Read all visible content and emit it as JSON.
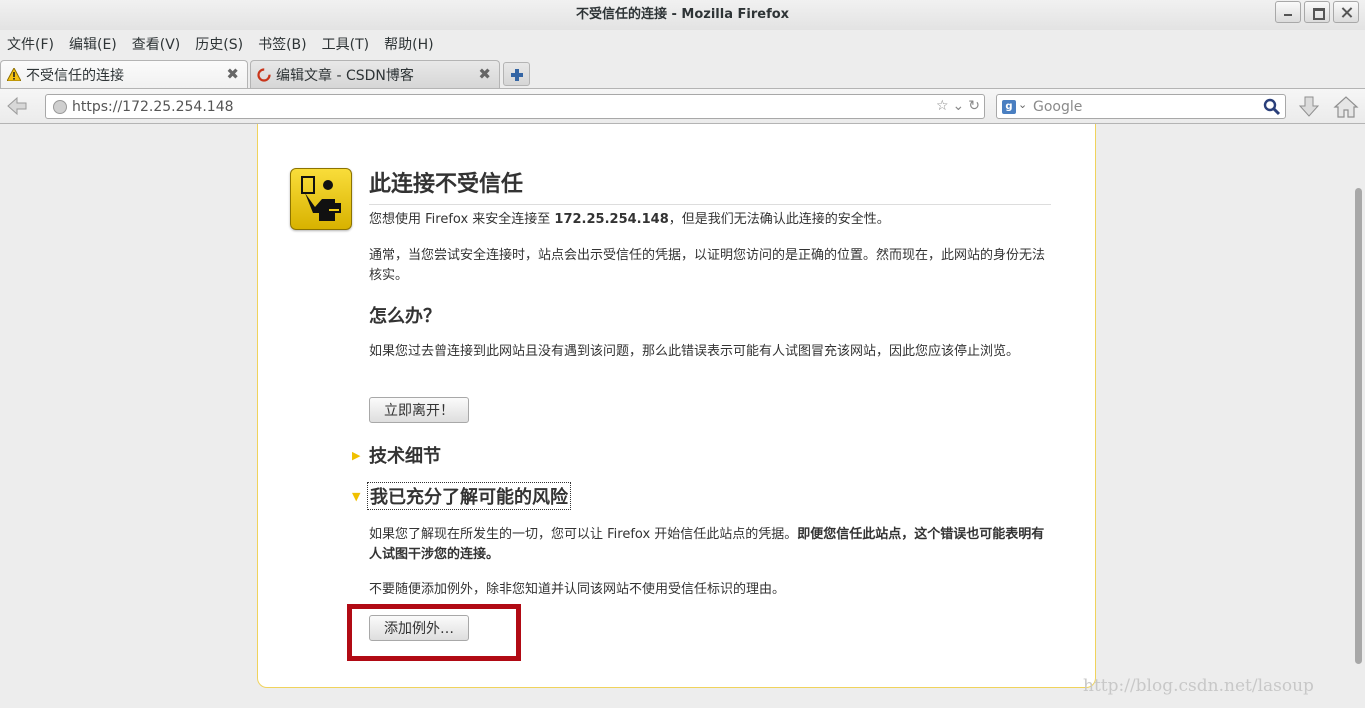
{
  "window": {
    "title": "不受信任的连接 - Mozilla Firefox"
  },
  "menubar": {
    "items": [
      "文件(F)",
      "编辑(E)",
      "查看(V)",
      "历史(S)",
      "书签(B)",
      "工具(T)",
      "帮助(H)"
    ]
  },
  "tabs": [
    {
      "label": "不受信任的连接",
      "icon": "warning-icon",
      "active": true
    },
    {
      "label": "编辑文章 - CSDN博客",
      "icon": "csdn-icon",
      "active": false
    }
  ],
  "navbar": {
    "url": "https://172.25.254.148",
    "search_placeholder": "Google"
  },
  "page": {
    "title": "此连接不受信任",
    "intro_prefix": "您想使用 Firefox 来安全连接至 ",
    "intro_host": "172.25.254.148",
    "intro_suffix": "，但是我们无法确认此连接的安全性。",
    "para2": "通常，当您尝试安全连接时，站点会出示受信任的凭据，以证明您访问的是正确的位置。然而现在，此网站的身份无法核实。",
    "what_heading": "怎么办？",
    "what_text": "如果您过去曾连接到此网站且没有遇到该问题，那么此错误表示可能有人试图冒充该网站，因此您应该停止浏览。",
    "leave_button": "立即离开！",
    "tech_heading": "技术细节",
    "risk_heading": "我已充分了解可能的风险",
    "risk_text_plain": "如果您了解现在所发生的一切，您可以让 Firefox 开始信任此站点的凭据。",
    "risk_text_bold": "即便您信任此站点，这个错误也可能表明有人试图干涉您的连接。",
    "risk_text2": "不要随便添加例外，除非您知道并认同该网站不使用受信任标识的理由。",
    "add_exception_button": "添加例外…"
  },
  "watermark": "http://blog.csdn.net/lasoup",
  "colors": {
    "highlight_box": "#b10a14",
    "error_border": "#f0d35c",
    "badge_yellow": "#f0cc1a"
  }
}
